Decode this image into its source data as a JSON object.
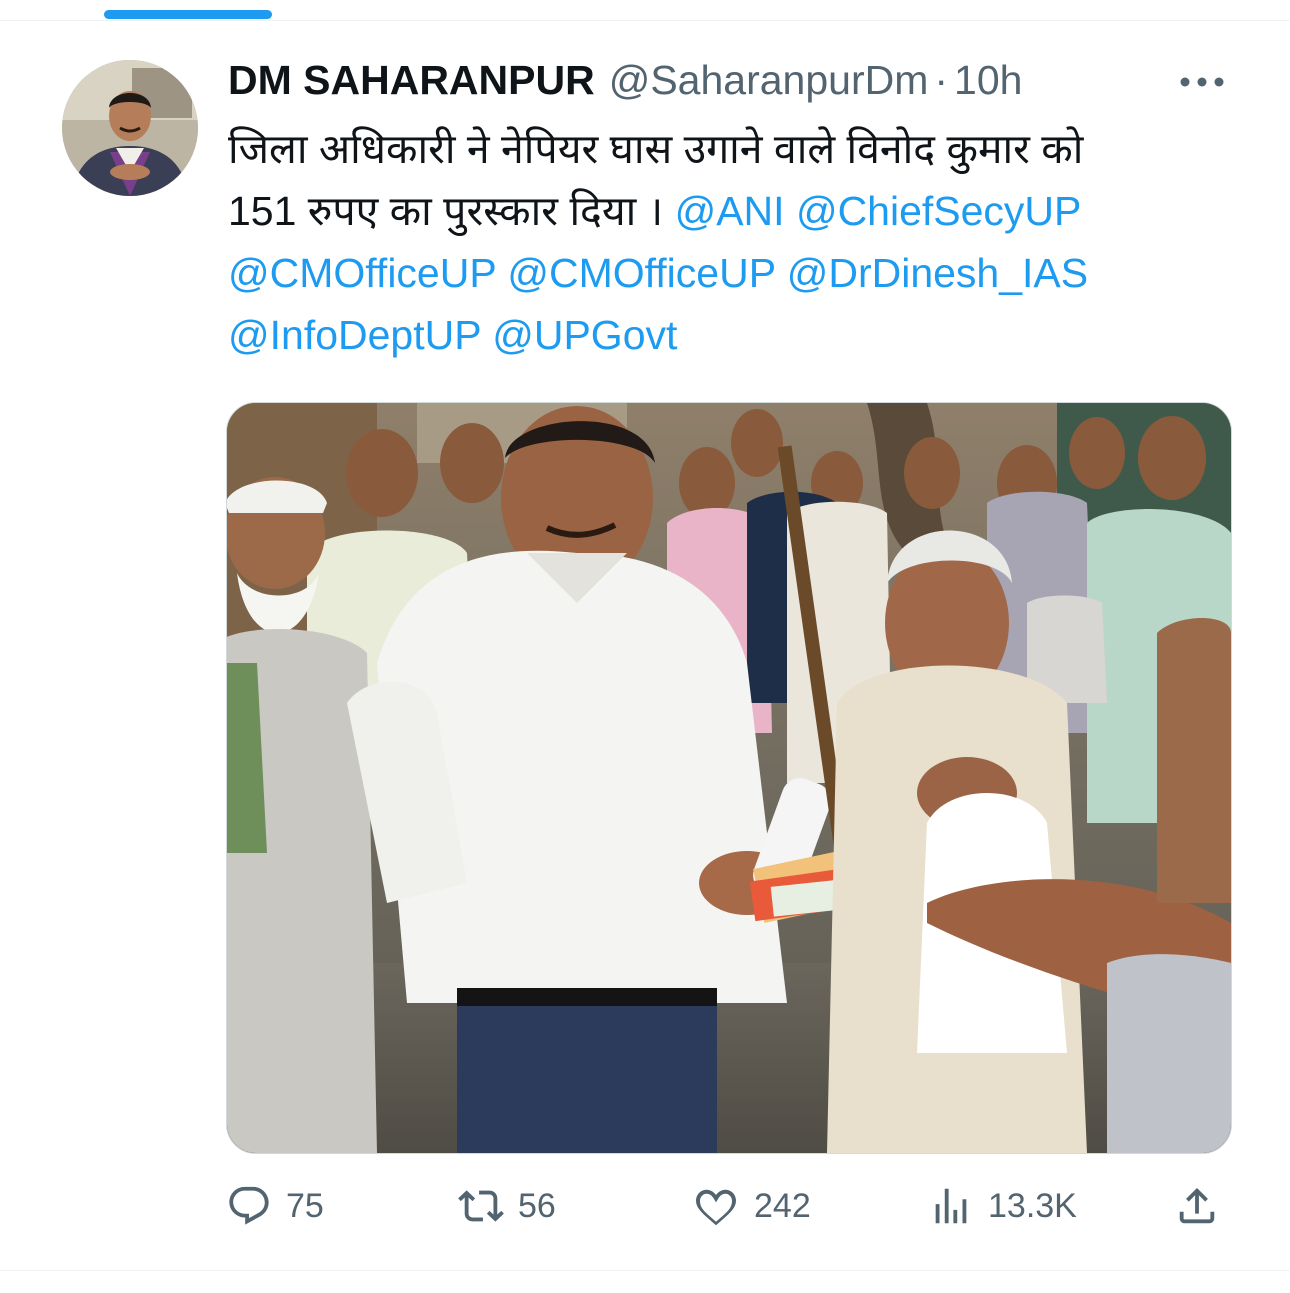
{
  "tweet": {
    "author": {
      "display_name": "DM SAHARANPUR",
      "handle": "@SaharanpurDm",
      "separator": "·",
      "time": "10h"
    },
    "text": {
      "line1": "जिला अधिकारी ने नेपियर घास उगाने वाले विनोद कुमार को",
      "line2": "151 रुपए का पुरस्कार दिया ।",
      "mentions": [
        "@ANI",
        "@ChiefSecyUP",
        "@CMOfficeUP",
        "@CMOfficeUP",
        "@DrDinesh_IAS",
        "@InfoDeptUP",
        "@UPGovt"
      ]
    },
    "stats": {
      "replies": "75",
      "reposts": "56",
      "likes": "242",
      "views": "13.3K"
    }
  },
  "icons": {
    "more": "more-dots-icon",
    "reply": "reply-bubble-icon",
    "repost": "repost-icon",
    "like": "heart-icon",
    "views": "views-chart-icon",
    "share": "share-icon"
  },
  "colors": {
    "accent": "#1d9bf0",
    "text_primary": "#0f1419",
    "text_secondary": "#536471",
    "divider": "#eff3f4"
  }
}
